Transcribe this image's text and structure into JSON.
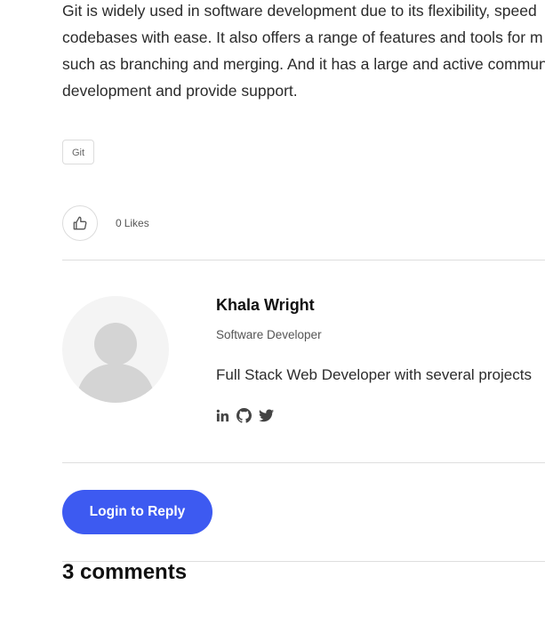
{
  "article": {
    "lines": [
      "Git is widely used in software development due to its flexibility, speed",
      "codebases with ease. It also offers a range of features and tools for m",
      "such as branching and merging. And it has a large and active commun",
      "development and provide support."
    ]
  },
  "tags": [
    "Git"
  ],
  "likes": {
    "count": "0",
    "label": "Likes",
    "icon": "thumbs-up-icon"
  },
  "author": {
    "name": "Khala Wright",
    "role": "Software Developer",
    "bio": "Full Stack Web Developer with several projects",
    "socials": [
      "linkedin-icon",
      "github-icon",
      "twitter-icon"
    ]
  },
  "actions": {
    "login_reply_label": "Login to Reply"
  },
  "comments": {
    "title": "3 comments"
  },
  "colors": {
    "accent": "#3d5af1",
    "divider": "#dedede"
  }
}
